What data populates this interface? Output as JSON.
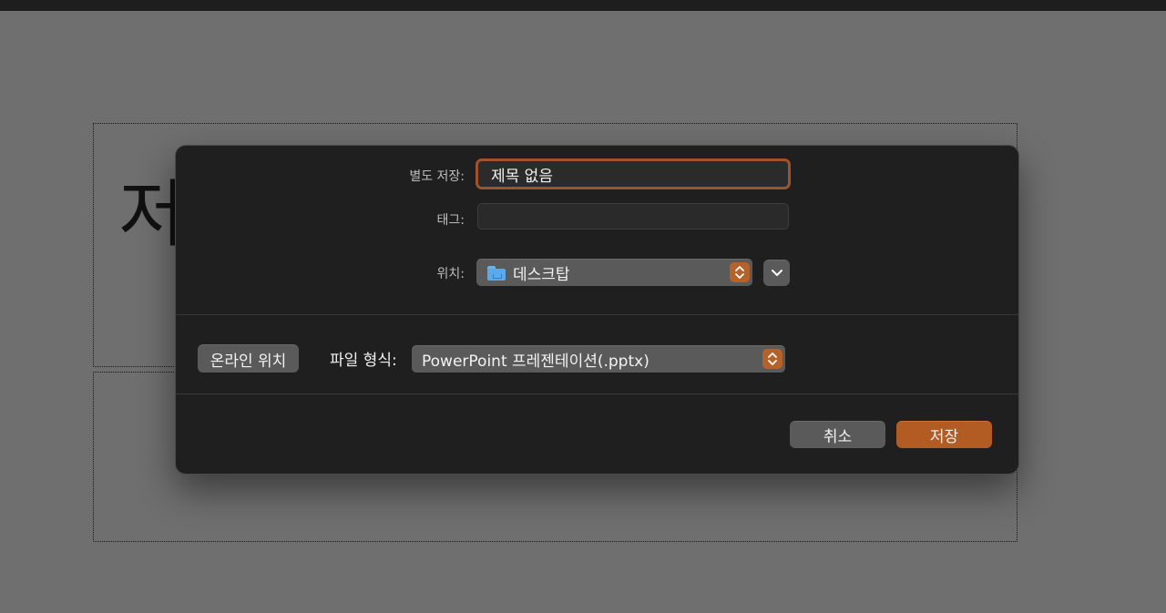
{
  "background": {
    "slide_title_text": "저"
  },
  "dialog": {
    "save_as_label": "별도 저장:",
    "file_name_value": "제목 없음",
    "tags_label": "태그:",
    "tags_value": "",
    "where_label": "위치:",
    "where_value": "데스크탑",
    "online_locations_label": "온라인 위치",
    "file_format_label": "파일 형식:",
    "file_format_value": "PowerPoint 프레젠테이션(.pptx)",
    "cancel_label": "취소",
    "save_label": "저장"
  },
  "colors": {
    "accent": "#b25c24",
    "focus_ring": "#a0522d",
    "folder": "#5aa9ea"
  },
  "icons": {
    "folder": "folder-icon",
    "stepper": "up-down-chevron-icon",
    "expand": "chevron-down-icon"
  }
}
